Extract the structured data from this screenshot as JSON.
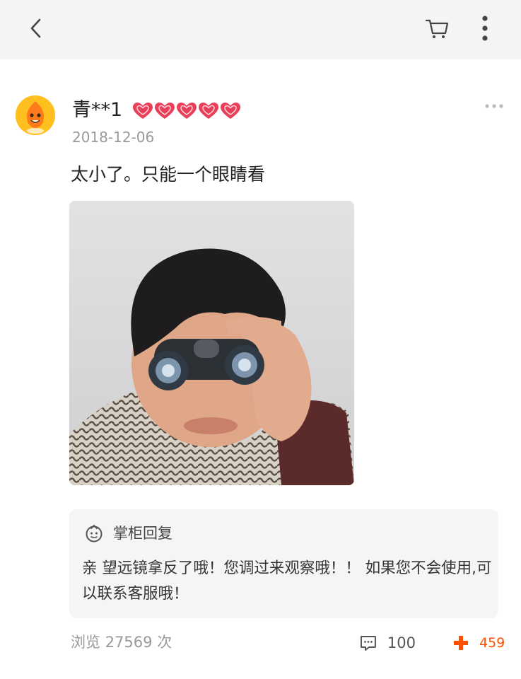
{
  "header": {
    "back_icon": "chevron-left-icon",
    "cart_icon": "cart-icon",
    "more_icon": "more-vertical-icon"
  },
  "review": {
    "username": "青**1",
    "level_badge_icon": "heart-level-icon",
    "level_badge_count": 5,
    "date": "2018-12-06",
    "text": "太小了。只能一个眼睛看",
    "photo_description": "person looking through binoculars"
  },
  "seller_reply": {
    "title": "掌柜回复",
    "text": "亲  望远镜拿反了哦！您调过来观察哦！！ 如果您不会使用,可以联系客服哦！"
  },
  "footer": {
    "views_label": "浏览",
    "views_count": "27569",
    "views_unit": "次",
    "comment_count": "100",
    "like_count": "459"
  },
  "colors": {
    "accent": "#ff5000",
    "heart": "#e8405a",
    "avatar": "#ffbf1e"
  }
}
